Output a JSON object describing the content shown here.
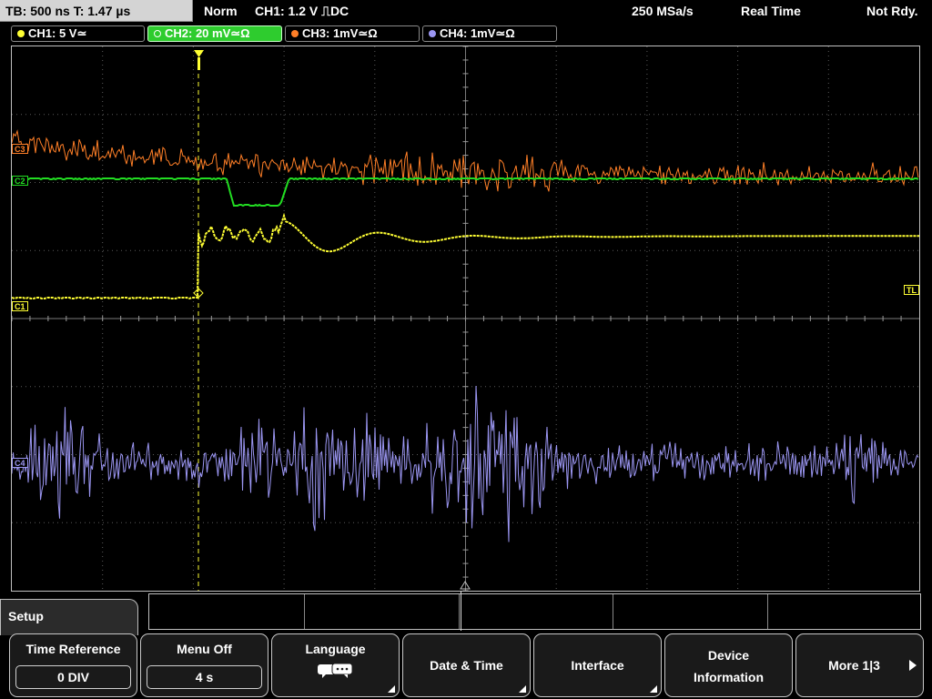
{
  "status_bar": {
    "timebase": "TB: 500 ns   T: 1.47 µs",
    "trigger_mode": "Norm",
    "trigger_info": "CH1: 1.2 V ⎍DC",
    "sample_rate": "250 MSa/s",
    "acq_mode": "Real Time",
    "acq_state": "Not Rdy."
  },
  "channels": [
    {
      "label": "CH1: 5 V≃",
      "color": "#ffff33"
    },
    {
      "label": "CH2: 20 mV≃Ω",
      "color": "#22dd22"
    },
    {
      "label": "CH3: 1mV≃Ω",
      "color": "#ff7f27"
    },
    {
      "label": "CH4: 1mV≃Ω",
      "color": "#9b96f2"
    }
  ],
  "markers": {
    "ch1": "C1",
    "trigger_level": "TL",
    "ch2": "C2",
    "ch3": "C3",
    "ch4": "C4"
  },
  "menu": {
    "title": "Setup",
    "time_reference": {
      "label": "Time Reference",
      "value": "0 DIV"
    },
    "menu_off": {
      "label": "Menu Off",
      "value": "4 s"
    },
    "language": {
      "label": "Language"
    },
    "date_time": {
      "label": "Date & Time"
    },
    "interface": {
      "label": "Interface"
    },
    "device_information": {
      "line1": "Device",
      "line2": "Information"
    },
    "more": {
      "label": "More 1|3"
    }
  }
}
